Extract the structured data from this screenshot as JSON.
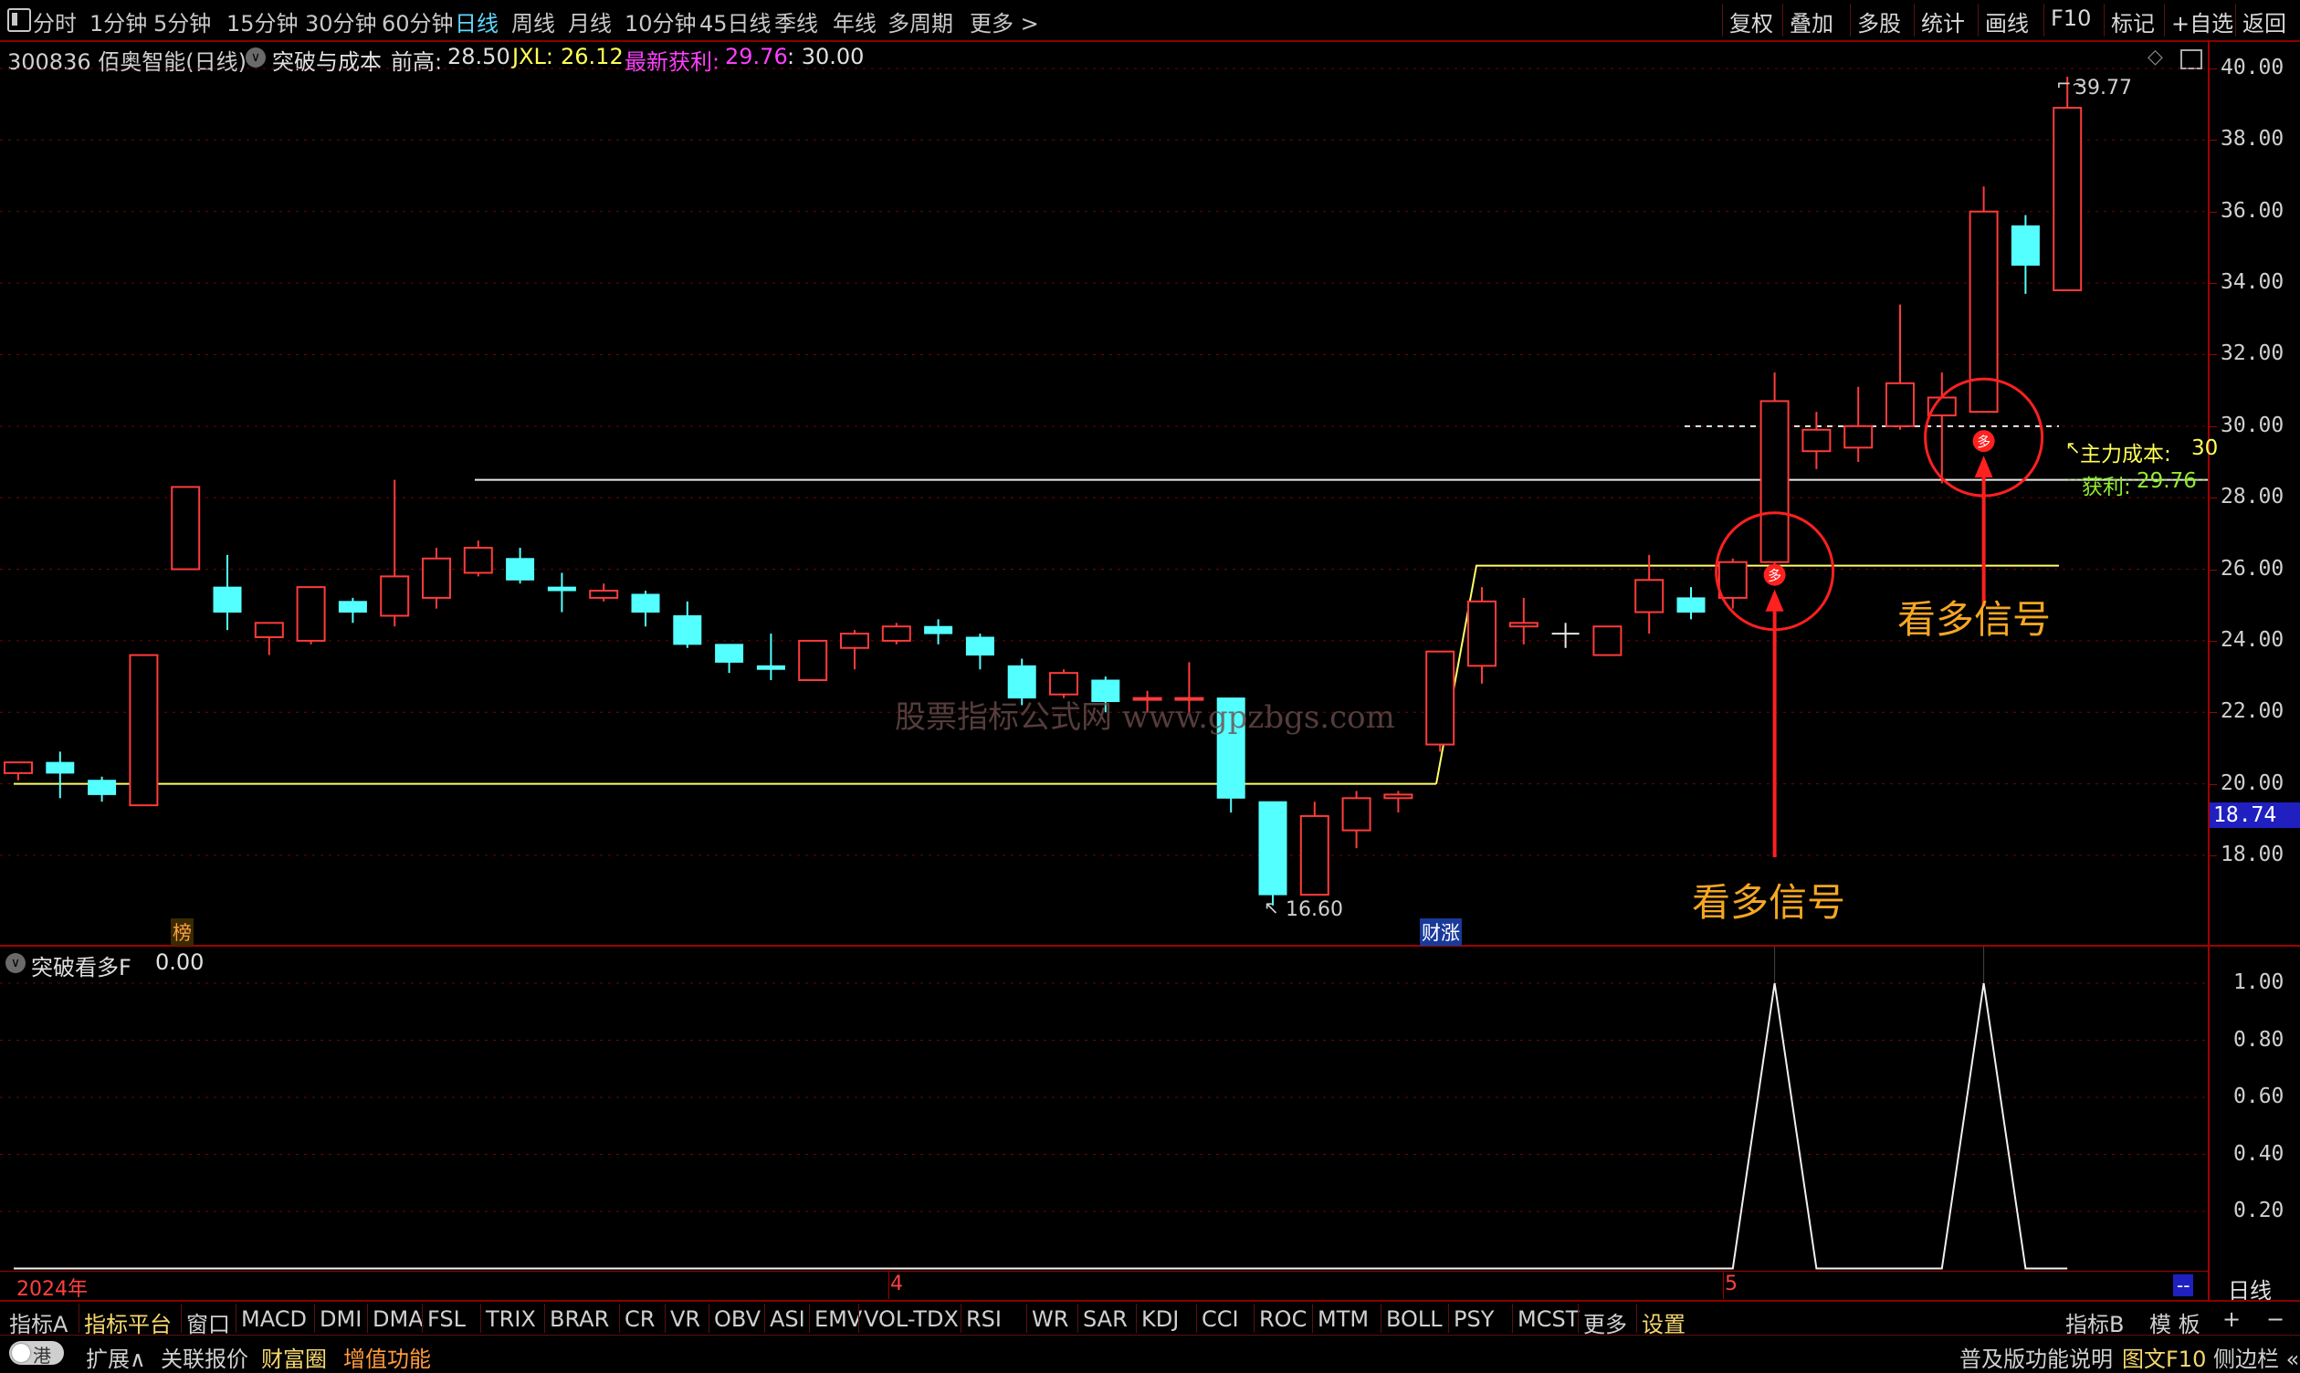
{
  "toolbar": {
    "periods": [
      "分时",
      "1分钟",
      "5分钟",
      "15分钟",
      "30分钟",
      "60分钟",
      "日线",
      "周线",
      "月线",
      "10分钟",
      "45日线",
      "季线",
      "年线",
      "多周期",
      "更多 >"
    ],
    "active_period": "日线",
    "right_buttons": [
      "复权",
      "叠加",
      "多股",
      "统计",
      "画线",
      "F10",
      "标记",
      "+自选",
      "返回"
    ]
  },
  "info": {
    "code_name": "300836 佰奥智能(日线)",
    "indicator_name": "突破与成本",
    "prev_high_label": "前高:",
    "prev_high_value": "28.50",
    "jxl_label": "JXL:",
    "jxl_value": "26.12",
    "profit_label": "最新获利:",
    "profit_value": "29.76",
    "extra_value": ": 30.00"
  },
  "price_axis": {
    "ticks": [
      "40.00",
      "38.00",
      "36.00",
      "34.00",
      "32.00",
      "30.00",
      "28.00",
      "26.00",
      "24.00",
      "22.00",
      "20.00",
      "18.00"
    ],
    "current_price": "18.74"
  },
  "chart_data": {
    "type": "candlestick",
    "title": "300836 佰奥智能(日线)",
    "ylim": [
      15.2,
      41.0
    ],
    "candles": [
      {
        "o": 20.3,
        "h": 20.6,
        "l": 20.1,
        "c": 20.6,
        "color": "red"
      },
      {
        "o": 20.6,
        "h": 20.9,
        "l": 19.6,
        "c": 20.3,
        "color": "cyan"
      },
      {
        "o": 20.1,
        "h": 20.2,
        "l": 19.5,
        "c": 19.7,
        "color": "cyan"
      },
      {
        "o": 19.4,
        "h": 23.6,
        "l": 19.4,
        "c": 23.6,
        "color": "red"
      },
      {
        "o": 26.0,
        "h": 28.3,
        "l": 26.0,
        "c": 28.3,
        "color": "red"
      },
      {
        "o": 25.5,
        "h": 26.4,
        "l": 24.3,
        "c": 24.8,
        "color": "cyan"
      },
      {
        "o": 24.1,
        "h": 24.5,
        "l": 23.6,
        "c": 24.5,
        "color": "red"
      },
      {
        "o": 24.0,
        "h": 25.5,
        "l": 23.9,
        "c": 25.5,
        "color": "red"
      },
      {
        "o": 25.1,
        "h": 25.2,
        "l": 24.5,
        "c": 24.8,
        "color": "cyan"
      },
      {
        "o": 24.7,
        "h": 28.5,
        "l": 24.4,
        "c": 25.8,
        "color": "red"
      },
      {
        "o": 25.2,
        "h": 26.6,
        "l": 24.9,
        "c": 26.3,
        "color": "red"
      },
      {
        "o": 25.9,
        "h": 26.8,
        "l": 25.8,
        "c": 26.6,
        "color": "red"
      },
      {
        "o": 26.3,
        "h": 26.6,
        "l": 25.6,
        "c": 25.7,
        "color": "cyan"
      },
      {
        "o": 25.5,
        "h": 25.9,
        "l": 24.8,
        "c": 25.4,
        "color": "cyan"
      },
      {
        "o": 25.2,
        "h": 25.6,
        "l": 25.1,
        "c": 25.4,
        "color": "red"
      },
      {
        "o": 25.3,
        "h": 25.4,
        "l": 24.4,
        "c": 24.8,
        "color": "cyan"
      },
      {
        "o": 24.7,
        "h": 25.1,
        "l": 23.8,
        "c": 23.9,
        "color": "cyan"
      },
      {
        "o": 23.9,
        "h": 23.9,
        "l": 23.1,
        "c": 23.4,
        "color": "cyan"
      },
      {
        "o": 23.3,
        "h": 24.2,
        "l": 22.9,
        "c": 23.2,
        "color": "cyan"
      },
      {
        "o": 22.9,
        "h": 24.0,
        "l": 22.9,
        "c": 24.0,
        "color": "red"
      },
      {
        "o": 23.8,
        "h": 24.3,
        "l": 23.2,
        "c": 24.2,
        "color": "red"
      },
      {
        "o": 24.0,
        "h": 24.5,
        "l": 23.9,
        "c": 24.4,
        "color": "red"
      },
      {
        "o": 24.4,
        "h": 24.6,
        "l": 23.9,
        "c": 24.2,
        "color": "cyan"
      },
      {
        "o": 24.1,
        "h": 24.2,
        "l": 23.2,
        "c": 23.6,
        "color": "cyan"
      },
      {
        "o": 23.3,
        "h": 23.5,
        "l": 22.2,
        "c": 22.4,
        "color": "cyan"
      },
      {
        "o": 22.5,
        "h": 23.2,
        "l": 22.4,
        "c": 23.1,
        "color": "red"
      },
      {
        "o": 22.9,
        "h": 23.0,
        "l": 22.0,
        "c": 22.3,
        "color": "cyan"
      },
      {
        "o": 22.4,
        "h": 22.6,
        "l": 22.0,
        "c": 22.4,
        "color": "red"
      },
      {
        "o": 22.4,
        "h": 23.4,
        "l": 22.0,
        "c": 22.4,
        "color": "red"
      },
      {
        "o": 22.4,
        "h": 22.4,
        "l": 19.2,
        "c": 19.6,
        "color": "cyan"
      },
      {
        "o": 19.5,
        "h": 19.5,
        "l": 16.6,
        "c": 16.9,
        "color": "cyan"
      },
      {
        "o": 16.9,
        "h": 19.5,
        "l": 16.9,
        "c": 19.1,
        "color": "red"
      },
      {
        "o": 18.7,
        "h": 19.8,
        "l": 18.2,
        "c": 19.6,
        "color": "red"
      },
      {
        "o": 19.6,
        "h": 19.8,
        "l": 19.2,
        "c": 19.7,
        "color": "red"
      },
      {
        "o": 21.1,
        "h": 23.7,
        "l": 20.9,
        "c": 23.7,
        "color": "red"
      },
      {
        "o": 23.3,
        "h": 25.5,
        "l": 22.8,
        "c": 25.1,
        "color": "red"
      },
      {
        "o": 24.4,
        "h": 25.2,
        "l": 23.9,
        "c": 24.5,
        "color": "red"
      },
      {
        "o": 24.2,
        "h": 24.5,
        "l": 23.8,
        "c": 24.2,
        "color": "white"
      },
      {
        "o": 23.6,
        "h": 24.4,
        "l": 23.6,
        "c": 24.4,
        "color": "red"
      },
      {
        "o": 24.8,
        "h": 26.4,
        "l": 24.2,
        "c": 25.7,
        "color": "red"
      },
      {
        "o": 24.8,
        "h": 25.5,
        "l": 24.6,
        "c": 25.2,
        "color": "cyan"
      },
      {
        "o": 25.2,
        "h": 26.3,
        "l": 24.9,
        "c": 26.2,
        "color": "red"
      },
      {
        "o": 26.2,
        "h": 31.5,
        "l": 25.9,
        "c": 30.7,
        "color": "red"
      },
      {
        "o": 29.3,
        "h": 30.4,
        "l": 28.8,
        "c": 29.9,
        "color": "red"
      },
      {
        "o": 29.4,
        "h": 31.1,
        "l": 29.0,
        "c": 30.0,
        "color": "red"
      },
      {
        "o": 30.0,
        "h": 33.4,
        "l": 29.9,
        "c": 31.2,
        "color": "red"
      },
      {
        "o": 30.3,
        "h": 31.5,
        "l": 28.4,
        "c": 30.8,
        "color": "red"
      },
      {
        "o": 30.4,
        "h": 36.7,
        "l": 30.4,
        "c": 36.0,
        "color": "red"
      },
      {
        "o": 35.6,
        "h": 35.9,
        "l": 33.7,
        "c": 34.5,
        "color": "cyan"
      },
      {
        "o": 33.8,
        "h": 39.77,
        "l": 33.8,
        "c": 38.9,
        "color": "red"
      }
    ],
    "price_labels": {
      "high": "39.77",
      "low": "16.60"
    },
    "lines": {
      "support_level": 20.0,
      "resistance_level": 28.5,
      "main_cost_level": 30.0
    },
    "signal_candles": [
      42,
      47
    ],
    "sub_indicator": {
      "name": "突破看多F",
      "value": "0.00",
      "ticks": [
        "1.00",
        "0.80",
        "0.60",
        "0.40",
        "0.20"
      ],
      "ylim": [
        0,
        1.12
      ],
      "values": [
        0,
        0,
        0,
        0,
        0,
        0,
        0,
        0,
        0,
        0,
        0,
        0,
        0,
        0,
        0,
        0,
        0,
        0,
        0,
        0,
        0,
        0,
        0,
        0,
        0,
        0,
        0,
        0,
        0,
        0,
        0,
        0,
        0,
        0,
        0,
        0,
        0,
        0,
        0,
        0,
        0,
        0,
        1,
        0,
        0,
        0,
        0,
        1,
        0,
        0
      ]
    }
  },
  "annotations": {
    "signal_text_1": "看多信号",
    "signal_text_2": "看多信号",
    "signal_badge": "多",
    "main_cost_label": "主力成本:",
    "main_cost_value": "30",
    "profit_short_label": "获利:",
    "profit_short_value": "29.76",
    "bang_tag": "榜",
    "caizhang_tag": "财涨",
    "watermark": "股票指标公式网 www.gpzbgs.com"
  },
  "time_axis": {
    "year_label": "2024年",
    "month_4": "4",
    "month_5": "5",
    "period_label": "日线",
    "arrow": "--"
  },
  "indicator_bar": {
    "items": [
      "指标A",
      "指标平台",
      "窗口",
      "MACD",
      "DMI",
      "DMA",
      "FSL",
      "TRIX",
      "BRAR",
      "CR",
      "VR",
      "OBV",
      "ASI",
      "EMV",
      "VOL-TDX",
      "RSI",
      "WR",
      "SAR",
      "KDJ",
      "CCI",
      "ROC",
      "MTM",
      "BOLL",
      "PSY",
      "MCST",
      "更多",
      "设置"
    ],
    "right": [
      "指标B",
      "模 板",
      "+",
      "−"
    ]
  },
  "ext_bar": {
    "toggle": "港",
    "items": [
      "扩展∧",
      "关联报价",
      "财富圈",
      "增值功能"
    ],
    "right": [
      "普及版功能说明",
      "图文F10",
      "侧边栏 «"
    ]
  }
}
